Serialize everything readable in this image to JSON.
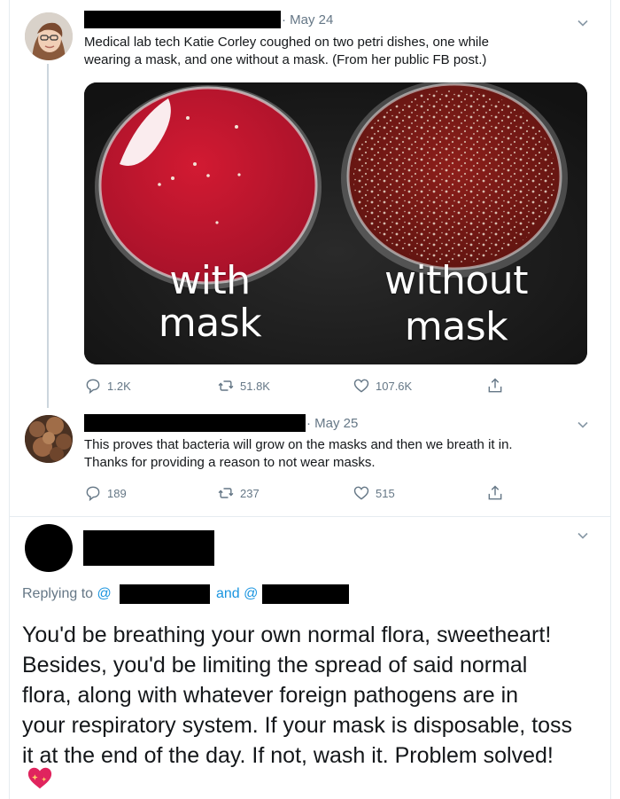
{
  "tweet1": {
    "date": "· May 24",
    "text_lines": [
      "Medical lab tech Katie Corley coughed on two petri dishes, one while",
      "wearing a mask, and one without a mask. (From her public FB post.)"
    ],
    "image": {
      "left_label_line1": "with",
      "left_label_line2": "mask",
      "right_label_line1": "without",
      "right_label_line2": "mask"
    },
    "actions": {
      "replies": "1.2K",
      "retweets": "51.8K",
      "likes": "107.6K"
    }
  },
  "tweet2": {
    "date": "· May 25",
    "text_lines": [
      "This proves that bacteria will grow on the masks and then we breath it in.",
      "Thanks for providing a reason to not wear masks."
    ],
    "actions": {
      "replies": "189",
      "retweets": "237",
      "likes": "515"
    }
  },
  "tweet3": {
    "replying_prefix": "Replying to",
    "at1": "@",
    "and_text": "and",
    "at2": "@",
    "text_lines": [
      "You'd be breathing your own normal flora, sweetheart!",
      "Besides, you'd be limiting the spread of said normal",
      "flora, along with whatever foreign pathogens are in",
      "your respiratory system. If your mask is disposable, toss",
      "it at the end of the day. If not, wash it. Problem solved!"
    ],
    "emoji": "sparkling-heart"
  },
  "colors": {
    "text": "#14171a",
    "muted": "#657786",
    "link": "#1b95e0",
    "agar": "#c0172e",
    "heart": "#e0245e"
  }
}
